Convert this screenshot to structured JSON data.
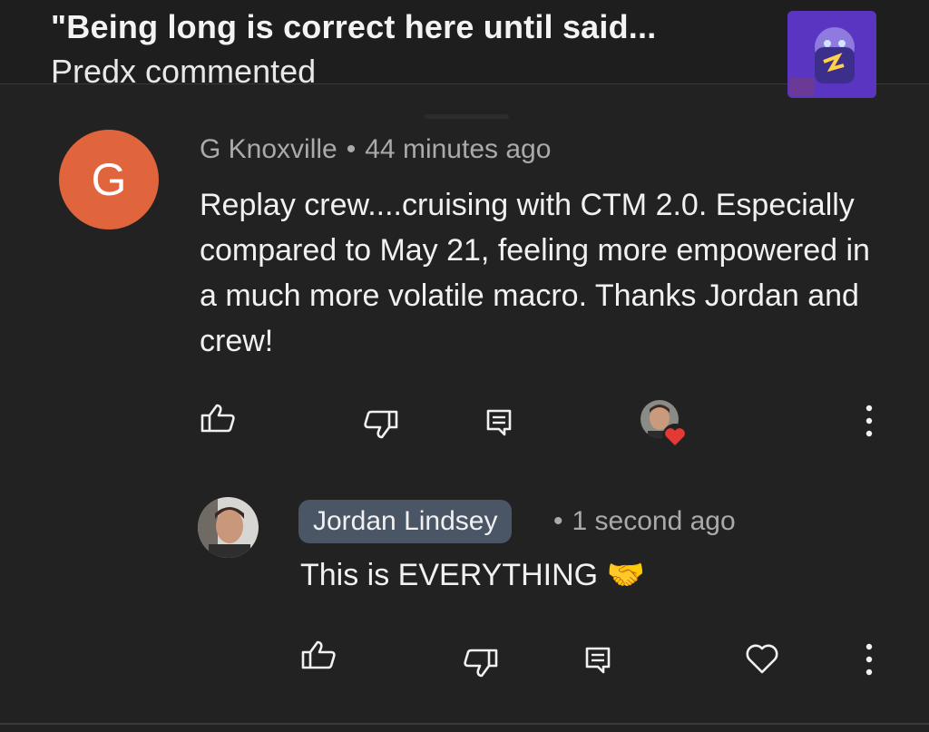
{
  "notification": {
    "title": "\"Being long is correct here until said...",
    "subtitle": "Predx commented",
    "thumbnail_icon": "video-thumbnail"
  },
  "comment": {
    "avatar_letter": "G",
    "avatar_color": "#e0643c",
    "author": "G Knoxville",
    "separator": "•",
    "time": "44 minutes ago",
    "text": "Replay crew....cruising with CTM 2.0. Especially compared to May 21, feeling more empowered in a much more volatile macro. Thanks Jordan and crew!",
    "actions": [
      "like-icon",
      "dislike-icon",
      "reply-icon",
      "creator-heart-icon",
      "more-icon"
    ]
  },
  "reply": {
    "author": "Jordan Lindsey",
    "separator": "•",
    "time": "1 second ago",
    "text": "This is EVERYTHING 🤝",
    "chip_color": "#4a5566",
    "actions": [
      "like-icon",
      "dislike-icon",
      "reply-icon",
      "heart-icon",
      "more-icon"
    ]
  },
  "colors": {
    "background": "#222222",
    "meta_text": "#aaaaaa",
    "heart_red": "#e53935"
  }
}
